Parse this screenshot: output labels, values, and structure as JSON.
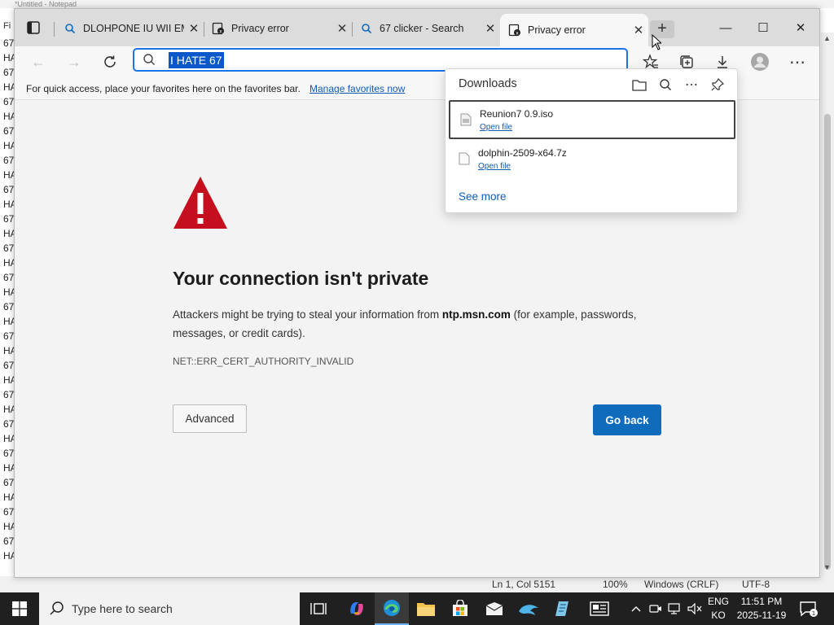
{
  "notepad": {
    "title_fragment": "*Untitled - Notepad",
    "menu_fragment": "Fi",
    "lines": [
      "67",
      "HA",
      "67",
      "HA",
      "67",
      "HA",
      "67",
      "HA",
      "67",
      "HA",
      "67",
      "HA",
      "67",
      "HA",
      "67",
      "HA",
      "67",
      "HA",
      "67",
      "HA",
      "67",
      "HA",
      "67",
      "HA",
      "67",
      "HA",
      "67",
      "HA",
      "67",
      "HA",
      "67",
      "HA",
      "67",
      "HA",
      "67",
      "HA"
    ],
    "status": {
      "position": "Ln 1, Col 5151",
      "zoom": "100%",
      "line_ending": "Windows (CRLF)",
      "encoding": "UTF-8"
    }
  },
  "browser": {
    "tabs": [
      {
        "label": "DLOHPONE IU WII EMU",
        "icon": "search-icon",
        "close": "✕"
      },
      {
        "label": "Privacy error",
        "icon": "cert-error-icon",
        "close": "✕"
      },
      {
        "label": "67 clicker - Search",
        "icon": "search-icon",
        "close": "✕"
      },
      {
        "label": "Privacy error",
        "icon": "cert-error-icon",
        "close": "✕",
        "active": true
      }
    ],
    "new_tab_label": "+",
    "window_controls": {
      "minimize": "—",
      "maximize": "☐",
      "close": "✕"
    },
    "address_value": "I HATE 67",
    "favorites_bar": {
      "text": "For quick access, place your favorites here on the favorites bar.",
      "link": "Manage favorites now"
    }
  },
  "error_page": {
    "title": "Your connection isn't private",
    "desc_prefix": "Attackers might be trying to steal your information from ",
    "desc_host": "ntp.msn.com",
    "desc_suffix": " (for example, passwords, messages, or credit cards).",
    "error_code": "NET::ERR_CERT_AUTHORITY_INVALID",
    "advanced_label": "Advanced",
    "go_back_label": "Go back",
    "accent": "#0f6cbd",
    "warning_color": "#c50f1f"
  },
  "downloads": {
    "title": "Downloads",
    "items": [
      {
        "filename": "Reunion7 0.9.iso",
        "action": "Open file"
      },
      {
        "filename": "dolphin-2509-x64.7z",
        "action": "Open file"
      }
    ],
    "see_more": "See more"
  },
  "taskbar": {
    "search_placeholder": "Type here to search",
    "lang_line1": "ENG",
    "lang_line2": "KO",
    "time": "11:51 PM",
    "date": "2025-11-19"
  }
}
